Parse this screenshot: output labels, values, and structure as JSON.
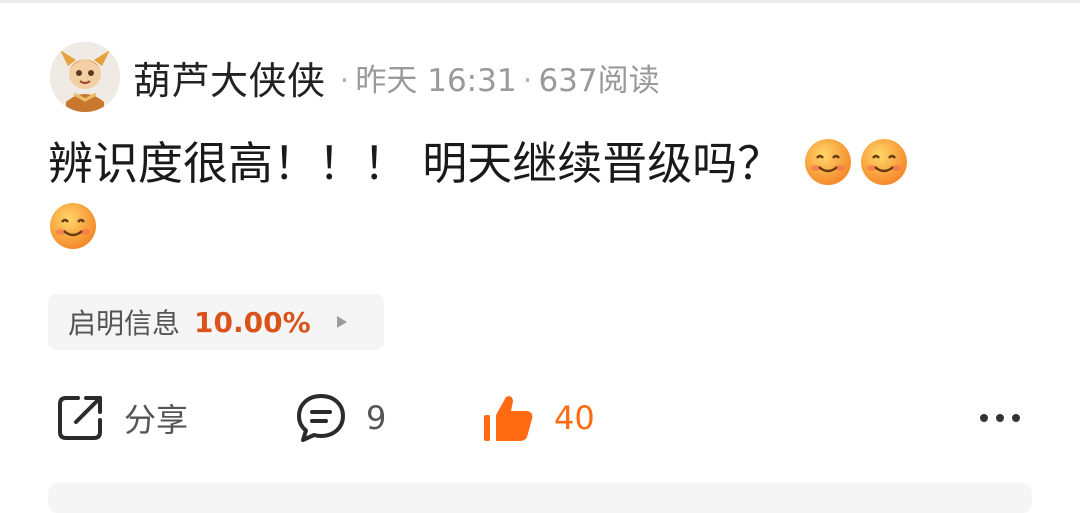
{
  "post": {
    "author": "葫芦大侠侠",
    "time": "昨天 16:31",
    "reads": "637阅读",
    "separator": "·",
    "text": "辨识度很高！！！ 明天继续晋级吗？",
    "emojis": [
      "smile-emoji",
      "smile-emoji",
      "smile-emoji"
    ]
  },
  "stock_tag": {
    "name": "启明信息",
    "change": "10.00%",
    "change_color": "#d8541b"
  },
  "actions": {
    "share_label": "分享",
    "comment_count": "9",
    "like_count": "40",
    "like_color": "#ff6a13"
  },
  "icons": {
    "share": "share-icon",
    "comment": "comment-icon",
    "like": "thumbs-up-icon",
    "more": "more-icon"
  }
}
